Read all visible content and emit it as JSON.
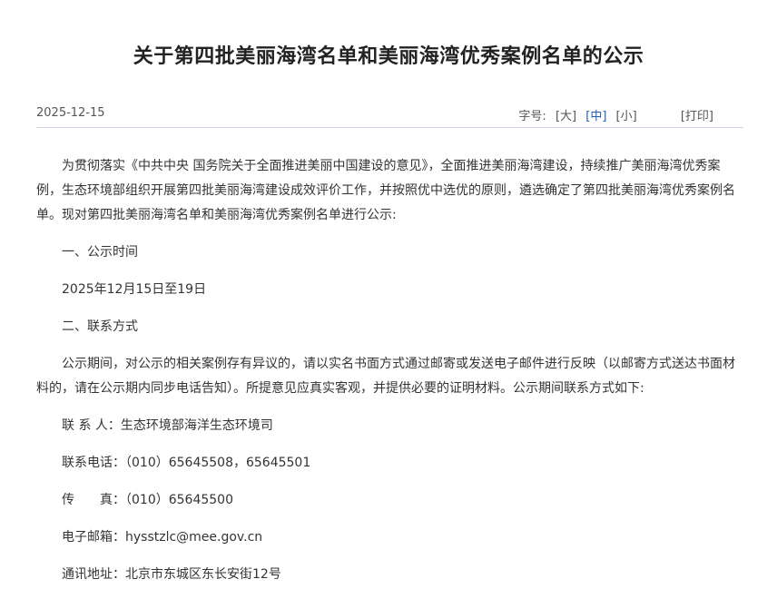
{
  "article": {
    "title": "关于第四批美丽海湾名单和美丽海湾优秀案例名单的公示",
    "date": "2025-12-15",
    "font_size_label": "字号:",
    "font_size_options": [
      "[大]",
      "[中]",
      "[小]"
    ],
    "font_size_active": "[中]",
    "print_label": "[打印]"
  },
  "body": {
    "intro": "为贯彻落实《中共中央 国务院关于全面推进美丽中国建设的意见》，全面推进美丽海湾建设，持续推广美丽海湾优秀案例，生态环境部组织开展第四批美丽海湾建设成效评价工作，并按照优中选优的原则，遴选确定了第四批美丽海湾优秀案例名单。现对第四批美丽海湾名单和美丽海湾优秀案例名单进行公示:",
    "section1_title": "一、公示时间",
    "section1_text": "2025年12月15日至19日",
    "section2_title": "二、联系方式",
    "section2_text": "公示期间，对公示的相关案例存有异议的，请以实名书面方式通过邮寄或发送电子邮件进行反映（以邮寄方式送达书面材料的，请在公示期内同步电话告知）。所提意见应真实客观，并提供必要的证明材料。公示期间联系方式如下:",
    "contact_person": "联 系 人：生态环境部海洋生态环境司",
    "phone": "联系电话：（010）65645508，65645501",
    "fax": "传　　真：（010）65645500",
    "email": "电子邮箱：hysstzlc@mee.gov.cn",
    "address": "通讯地址：北京市东城区东长安街12号"
  },
  "colors": {
    "accent": "#1f5fb5",
    "divider": "#c9d3e0",
    "text": "#333333"
  }
}
